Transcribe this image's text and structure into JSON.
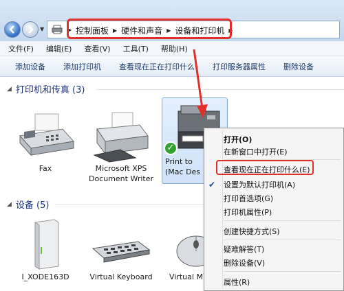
{
  "address": {
    "crumbs": [
      "控制面板",
      "硬件和声音",
      "设备和打印机"
    ]
  },
  "menu": [
    "文件(F)",
    "编辑(E)",
    "查看(V)",
    "工具(T)",
    "帮助(H)"
  ],
  "toolbar": [
    "添加设备",
    "添加打印机",
    "查看现在正在打印什么",
    "打印服务器属性",
    "删除设备"
  ],
  "groups": {
    "printers": {
      "title": "打印机和传真 (3)"
    },
    "devices": {
      "title": "设备 (5)"
    }
  },
  "printers": [
    {
      "label": "Fax"
    },
    {
      "label": "Microsoft XPS Document Writer"
    },
    {
      "label": "Print to (Mac Des"
    }
  ],
  "devices": [
    {
      "label": "I_XODE163D"
    },
    {
      "label": "Virtual Keyboard"
    },
    {
      "label": "Virtual M"
    }
  ],
  "context_menu": [
    {
      "label": "打开(O)"
    },
    {
      "label": "在新窗口中打开(E)"
    },
    {
      "label": "查看现在正在打印什么(E)"
    },
    {
      "label": "设置为默认打印机(A)"
    },
    {
      "label": "打印首选项(G)"
    },
    {
      "label": "打印机属性(P)"
    },
    {
      "label": "创建快捷方式(S)"
    },
    {
      "label": "疑难解答(T)"
    },
    {
      "label": "删除设备(V)"
    },
    {
      "label": "属性(R)"
    }
  ],
  "colors": {
    "highlight": "#e0302a",
    "link": "#1e3287"
  }
}
